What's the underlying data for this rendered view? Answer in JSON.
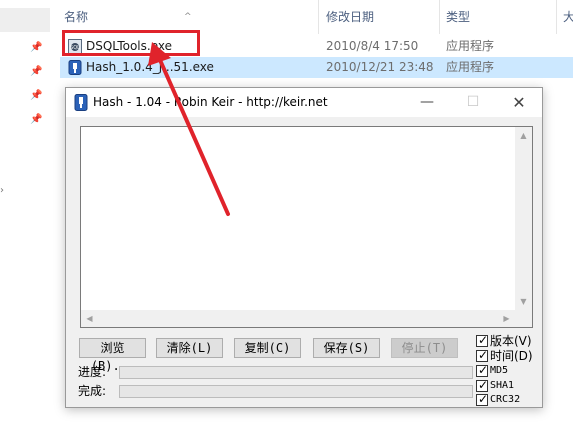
{
  "explorer": {
    "columns": {
      "name": "名称",
      "date": "修改日期",
      "type": "类型",
      "size": "大"
    },
    "files": [
      {
        "name": "DSQLTools.exe",
        "date": "2010/8/4 17:50",
        "type": "应用程序",
        "selected": false
      },
      {
        "name": "Hash_1.0.4_j...51.exe",
        "date": "2010/12/21 23:48",
        "type": "应用程序",
        "selected": true
      }
    ]
  },
  "hash_window": {
    "title": "Hash - 1.04 - Robin Keir - http://keir.net",
    "output_text": "",
    "buttons": {
      "browse": "浏览(B)...",
      "clear": "清除(L)",
      "copy": "复制(C)",
      "save": "保存(S)",
      "stop": "停止(T)"
    },
    "progress": {
      "label": "进度:",
      "value": 0
    },
    "complete": {
      "label": "完成:",
      "value": 0
    },
    "options": [
      {
        "label": "版本(V)",
        "checked": true,
        "style": "cjk"
      },
      {
        "label": "时间(D)",
        "checked": true,
        "style": "cjk"
      },
      {
        "label": "MD5",
        "checked": true,
        "style": "mono"
      },
      {
        "label": "SHA1",
        "checked": true,
        "style": "mono"
      },
      {
        "label": "CRC32",
        "checked": true,
        "style": "mono"
      }
    ]
  },
  "colors": {
    "annotation": "#e0232b",
    "selection": "#cce8ff"
  }
}
